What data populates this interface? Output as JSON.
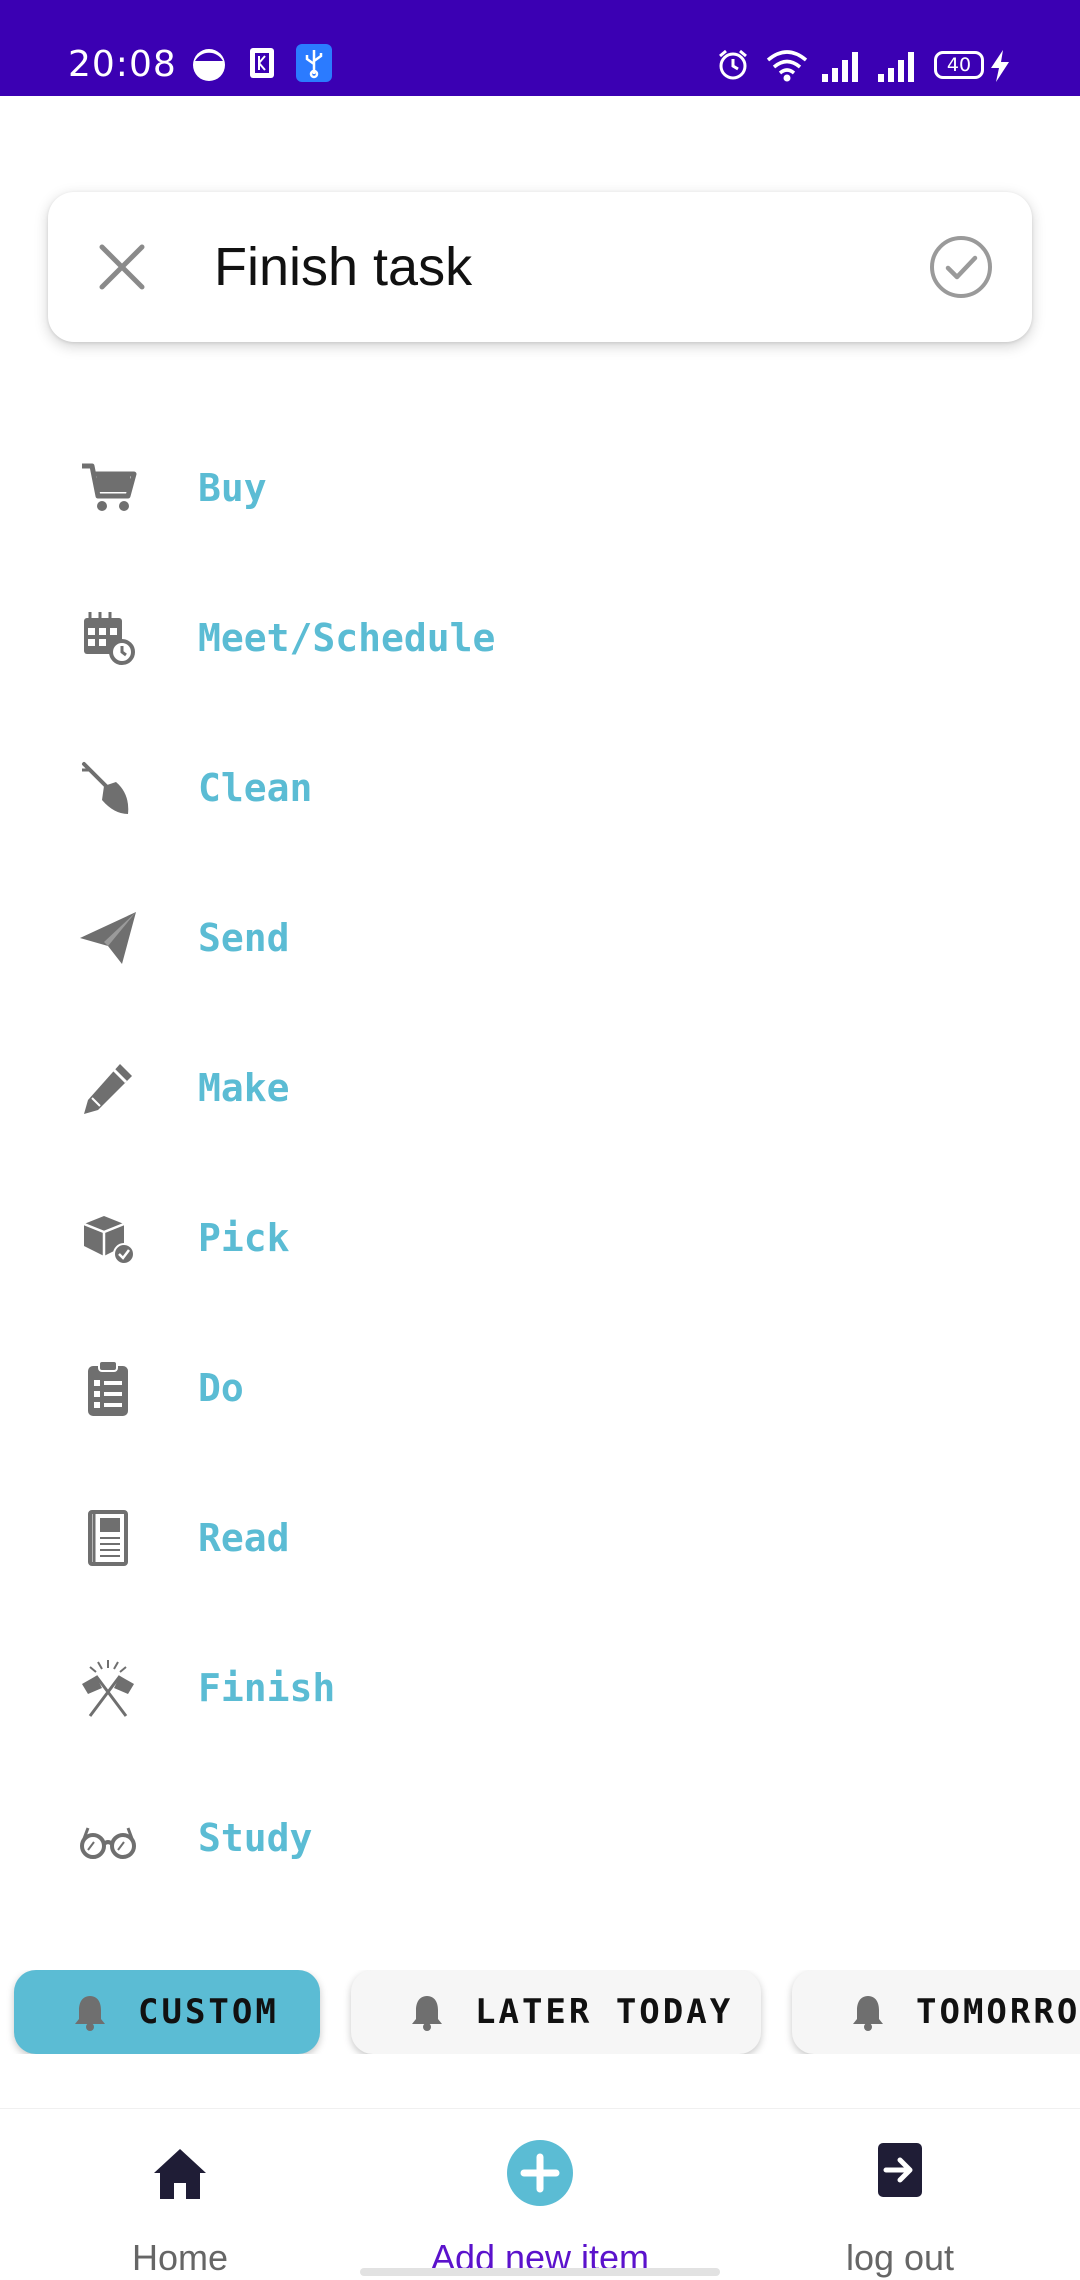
{
  "status_bar": {
    "time": "20:08",
    "battery": "40",
    "color": "#3b00b3",
    "left_icons": [
      "half-moon-icon",
      "k-square-icon",
      "usb-icon"
    ],
    "right_icons": [
      "alarm-icon",
      "wifi-icon",
      "signal-icon",
      "signal-icon",
      "battery-icon",
      "charging-icon"
    ]
  },
  "search": {
    "value": "Finish task",
    "placeholder": ""
  },
  "categories": [
    {
      "label": "Buy",
      "icon": "shopping-cart-icon"
    },
    {
      "label": "Meet/Schedule",
      "icon": "calendar-clock-icon"
    },
    {
      "label": "Clean",
      "icon": "broom-icon"
    },
    {
      "label": "Send",
      "icon": "paper-plane-icon"
    },
    {
      "label": "Make",
      "icon": "pencil-icon"
    },
    {
      "label": "Pick",
      "icon": "package-check-icon"
    },
    {
      "label": "Do",
      "icon": "clipboard-list-icon"
    },
    {
      "label": "Read",
      "icon": "book-icon"
    },
    {
      "label": "Finish",
      "icon": "crossed-flags-icon"
    },
    {
      "label": "Study",
      "icon": "glasses-icon"
    }
  ],
  "reminders": [
    {
      "label": "CUSTOM",
      "selected": true
    },
    {
      "label": "LATER TODAY",
      "selected": false
    },
    {
      "label": "TOMORROW",
      "selected": false
    }
  ],
  "nav": {
    "home": "Home",
    "add": "Add new item",
    "logout": "log out"
  },
  "colors": {
    "accent": "#5bbcd4",
    "active_nav": "#5b12cc",
    "icon_gray": "#6f6f6f",
    "nav_icon_dark": "#1f1d36"
  }
}
